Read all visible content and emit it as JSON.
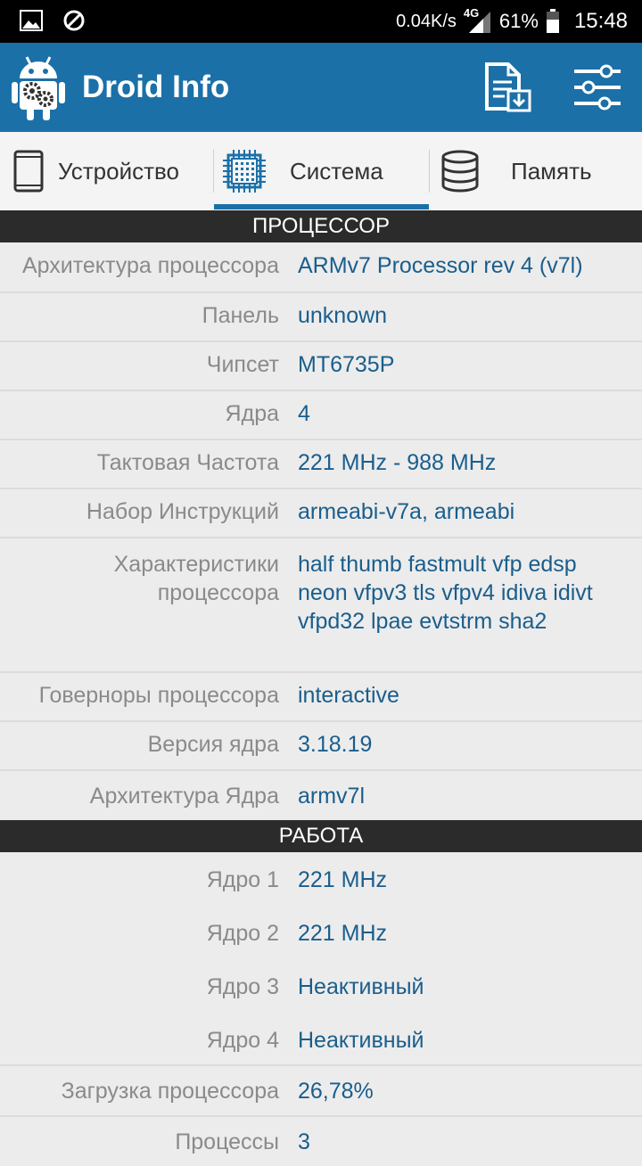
{
  "status_bar": {
    "speed": "0.04K/s",
    "network": "4G",
    "battery": "61%",
    "time": "15:48"
  },
  "app_bar": {
    "title": "Droid Info"
  },
  "tabs": [
    {
      "label": "Устройство",
      "icon": "phone-icon"
    },
    {
      "label": "Система",
      "icon": "cpu-chip-icon"
    },
    {
      "label": "Память",
      "icon": "database-icon"
    }
  ],
  "processor": {
    "header": "ПРОЦЕССОР",
    "rows": [
      {
        "label": "Архитектура процессора",
        "value": "ARMv7 Processor rev 4 (v7l)"
      },
      {
        "label": "Панель",
        "value": "unknown"
      },
      {
        "label": "Чипсет",
        "value": "MT6735P"
      },
      {
        "label": "Ядра",
        "value": "4"
      },
      {
        "label": "Тактовая Частота",
        "value": "221 MHz - 988 MHz"
      },
      {
        "label": "Набор Инструкций",
        "value": "armeabi-v7a, armeabi"
      },
      {
        "label": "Характеристики процессора",
        "value": "half thumb fastmult vfp edsp neon vfpv3 tls vfpv4 idiva idivt vfpd32 lpae evtstrm sha2"
      },
      {
        "label": "Говерноры процессора",
        "value": "interactive"
      },
      {
        "label": "Версия ядра",
        "value": "3.18.19"
      },
      {
        "label": "Архитектура Ядра",
        "value": "armv7l"
      }
    ]
  },
  "work": {
    "header": "РАБОТА",
    "cores": [
      {
        "label": "Ядро 1",
        "value": "221 MHz"
      },
      {
        "label": "Ядро 2",
        "value": "221 MHz"
      },
      {
        "label": "Ядро 3",
        "value": "Неактивный"
      },
      {
        "label": "Ядро 4",
        "value": "Неактивный"
      }
    ],
    "rows": [
      {
        "label": "Загрузка процессора",
        "value": "26,78%"
      },
      {
        "label": "Процессы",
        "value": "3"
      }
    ]
  }
}
